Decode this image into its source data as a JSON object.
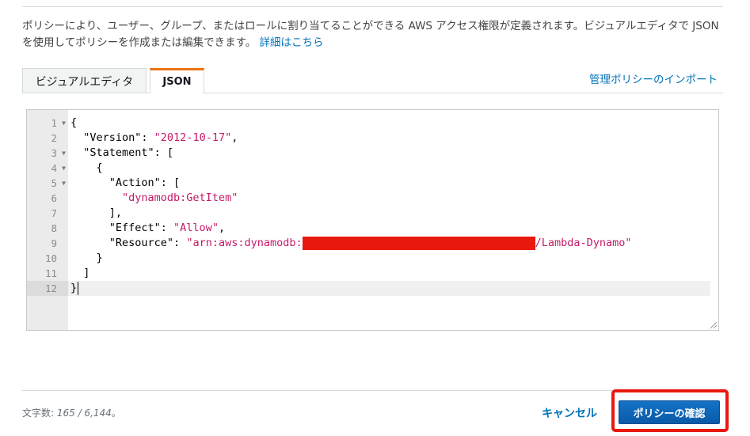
{
  "description": {
    "text": "ポリシーにより、ユーザー、グループ、またはロールに割り当てることができる AWS アクセス権限が定義されます。ビジュアルエディタで JSON を使用してポリシーを作成または編集できます。",
    "link": "詳細はこちら"
  },
  "tabs": [
    {
      "label": "ビジュアルエディタ",
      "active": false
    },
    {
      "label": "JSON",
      "active": true
    }
  ],
  "import_link": "管理ポリシーのインポート",
  "editor": {
    "line_numbers": [
      "1",
      "2",
      "3",
      "4",
      "5",
      "6",
      "7",
      "8",
      "9",
      "10",
      "11",
      "12"
    ],
    "lines": {
      "l1": "{",
      "l2_key": "  \"Version\": ",
      "l2_val": "\"2012-10-17\"",
      "l2_end": ",",
      "l3": "  \"Statement\": [",
      "l4": "    {",
      "l5": "      \"Action\": [",
      "l6_val": "        \"dynamodb:GetItem\"",
      "l7": "      ],",
      "l8_key": "      \"Effect\": ",
      "l8_val": "\"Allow\"",
      "l8_end": ",",
      "l9_key": "      \"Resource\": ",
      "l9_val_start": "\"arn:aws:dynamodb:",
      "l9_val_end": "/Lambda-Dynamo\"",
      "l10": "    }",
      "l11": "  ]",
      "l12": "}"
    }
  },
  "footer": {
    "char_count_label": "文字数: ",
    "char_count_value": "165 / 6,144",
    "char_count_suffix": "。",
    "cancel": "キャンセル",
    "confirm": "ポリシーの確認"
  },
  "colors": {
    "accent_tab": "#ec7211",
    "link": "#0073bb",
    "string": "#c41a68",
    "highlight_box": "#e8190f",
    "primary_button": "#0a66b8"
  }
}
